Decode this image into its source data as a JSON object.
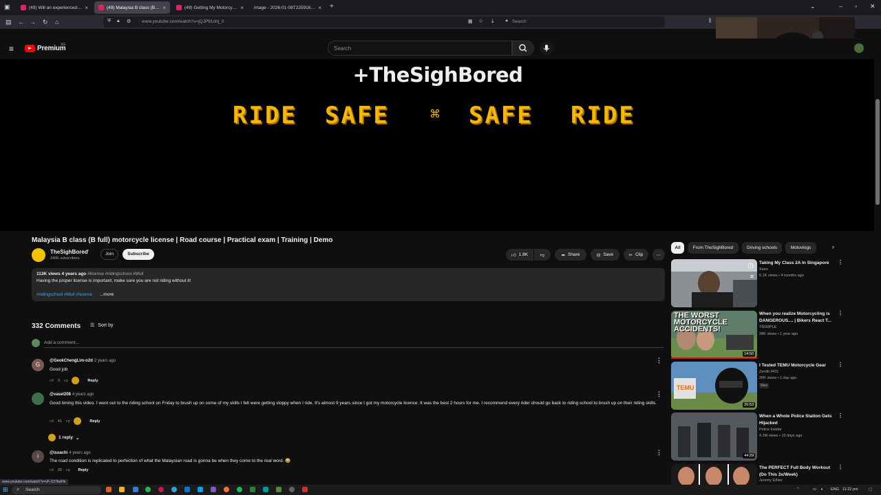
{
  "browser": {
    "tabs": [
      {
        "label": "(49) Will an experienced rider p"
      },
      {
        "label": "(49) Malaysia B class (B full) mo"
      },
      {
        "label": "(49) Getting My Motorcycle Lic"
      },
      {
        "label": "image - 2026-01-08T225916.570.j"
      }
    ],
    "url": "www.youtube.com/watch?v=jQJP91ohj_0",
    "search_placeholder": "Search",
    "status_url": "www.youtube.com/watch?v=vF-O27kwFik"
  },
  "youtube": {
    "logo_text": "Premium",
    "logo_sup": "SG",
    "search_placeholder": "Search"
  },
  "video": {
    "overlay_title": "+TheSighBored",
    "overlay_words": [
      "RIDE",
      "SAFE",
      "SAFE",
      "RIDE"
    ],
    "title": "Malaysia B class (B full) motorcycle license | Road course | Practical exam | Training | Demo",
    "channel": "TheSighBored",
    "subscribers": "240K subscribers",
    "join_label": "Join",
    "subscribe_label": "Subscribe",
    "likes": "1.8K",
    "share_label": "Share",
    "save_label": "Save",
    "clip_label": "Clip",
    "views_date": "113K views  4 years ago",
    "header_tags": "#license #ridingschool #bfull",
    "description": "Having the proper license is important, make sure you are not riding without it!",
    "desc_tags": "#ridingschool #bfull #license",
    "more_label": "...more"
  },
  "comments": {
    "count_label": "332 Comments",
    "sort_label": "Sort by",
    "add_placeholder": "Add a comment...",
    "items": [
      {
        "author": "@GeokChengLim-o2d",
        "ago": "2 years ago",
        "text": "Good job",
        "likes": "3",
        "reply": "Reply"
      },
      {
        "author": "@vasel208",
        "ago": "4 years ago",
        "text": "Good timing this video. I went out to the riding school on Friday to brush up on some of my skills I felt were getting sloppy when I ride. It's almost 9 years since I got my motorcycle licence. It was the best 2 hours for me. I recommend every rider should go back to riding school to brush up on their riding skills.",
        "likes": "41",
        "reply": "Reply"
      },
      {
        "author": "@issachi",
        "ago": "4 years ago",
        "text": "The road condition is replicated to perfection of what the Malaysian road is gonna be when they come to the real word. 😂",
        "likes": "20",
        "reply": "Reply"
      }
    ],
    "replies_label": "1 reply"
  },
  "sidebar": {
    "chips": [
      "All",
      "From TheSighBored",
      "Driving schools",
      "Motovlogs"
    ],
    "recommendations": [
      {
        "title": "Taking My Class 2A In Singapore",
        "channel": "Xaen",
        "meta": "6.1K views • 4 months ago",
        "duration": ""
      },
      {
        "title": "When you realize Motorcycling is DANGEROUS.... | Bikers React T...",
        "channel": "TRI33PLE",
        "meta": "28K views • 1 year ago",
        "duration": "14:50",
        "thumb_text": "THE WORST MOTORCYCLE ACCIDENTS!"
      },
      {
        "title": "I Tested TEMU Motorcycle Gear",
        "channel": "Zenith FRS",
        "meta": "26K views • 1 day ago",
        "duration": "20:53",
        "badge": "New",
        "thumb_text": "TEMU"
      },
      {
        "title": "When a Whole Police Station Gets Hijacked",
        "channel": "Police Insider",
        "meta": "4.1M views • 10 days ago",
        "duration": "44:29"
      },
      {
        "title": "The PERFECT Full Body Workout (Do This 3x/Week)",
        "channel": "Jeremy Ethier",
        "meta": "",
        "duration": ""
      }
    ]
  },
  "taskbar": {
    "search_label": "Search",
    "lang": "ENG",
    "time": "11:22 pm"
  }
}
